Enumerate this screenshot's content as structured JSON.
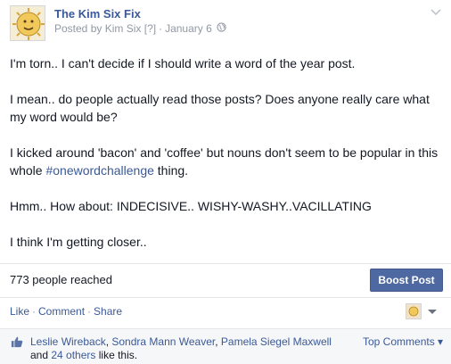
{
  "header": {
    "page_name": "The Kim Six Fix",
    "posted_by_prefix": "Posted by",
    "author": "Kim Six",
    "help_marker": "[?]",
    "separator": "·",
    "date": "January 6"
  },
  "post": {
    "paragraphs": [
      "I'm torn.. I can't decide if I should write a word of the year post.",
      "I mean.. do people actually read those posts? Does anyone really care what my word would be?",
      "Hmm.. How about: INDECISIVE.. WISHY-WASHY..VACILLATING",
      "I think I'm getting closer.."
    ],
    "paragraph3_before": "I kicked around 'bacon' and 'coffee' but nouns don't seem to be popular in this whole ",
    "hashtag": "#onewordchallenge",
    "paragraph3_after": " thing."
  },
  "reach": {
    "text": "773 people reached",
    "boost_label": "Boost Post"
  },
  "actions": {
    "like": "Like",
    "comment": "Comment",
    "share": "Share",
    "dot": "·"
  },
  "likes": {
    "names": [
      "Leslie Wireback",
      "Sondra Mann Weaver",
      "Pamela Siegel Maxwell"
    ],
    "sep": ", ",
    "and_text": "and ",
    "others_link": "24 others",
    "tail_text": " like this.",
    "top_comments": "Top Comments ▾"
  },
  "colors": {
    "link": "#3b5998",
    "boost_button": "#4e69a2",
    "meta_gray": "#9197a3"
  },
  "icons": [
    "page-avatar-icon",
    "globe-icon",
    "chevron-down-icon",
    "thumbs-up-icon",
    "dropdown-caret-icon"
  ]
}
